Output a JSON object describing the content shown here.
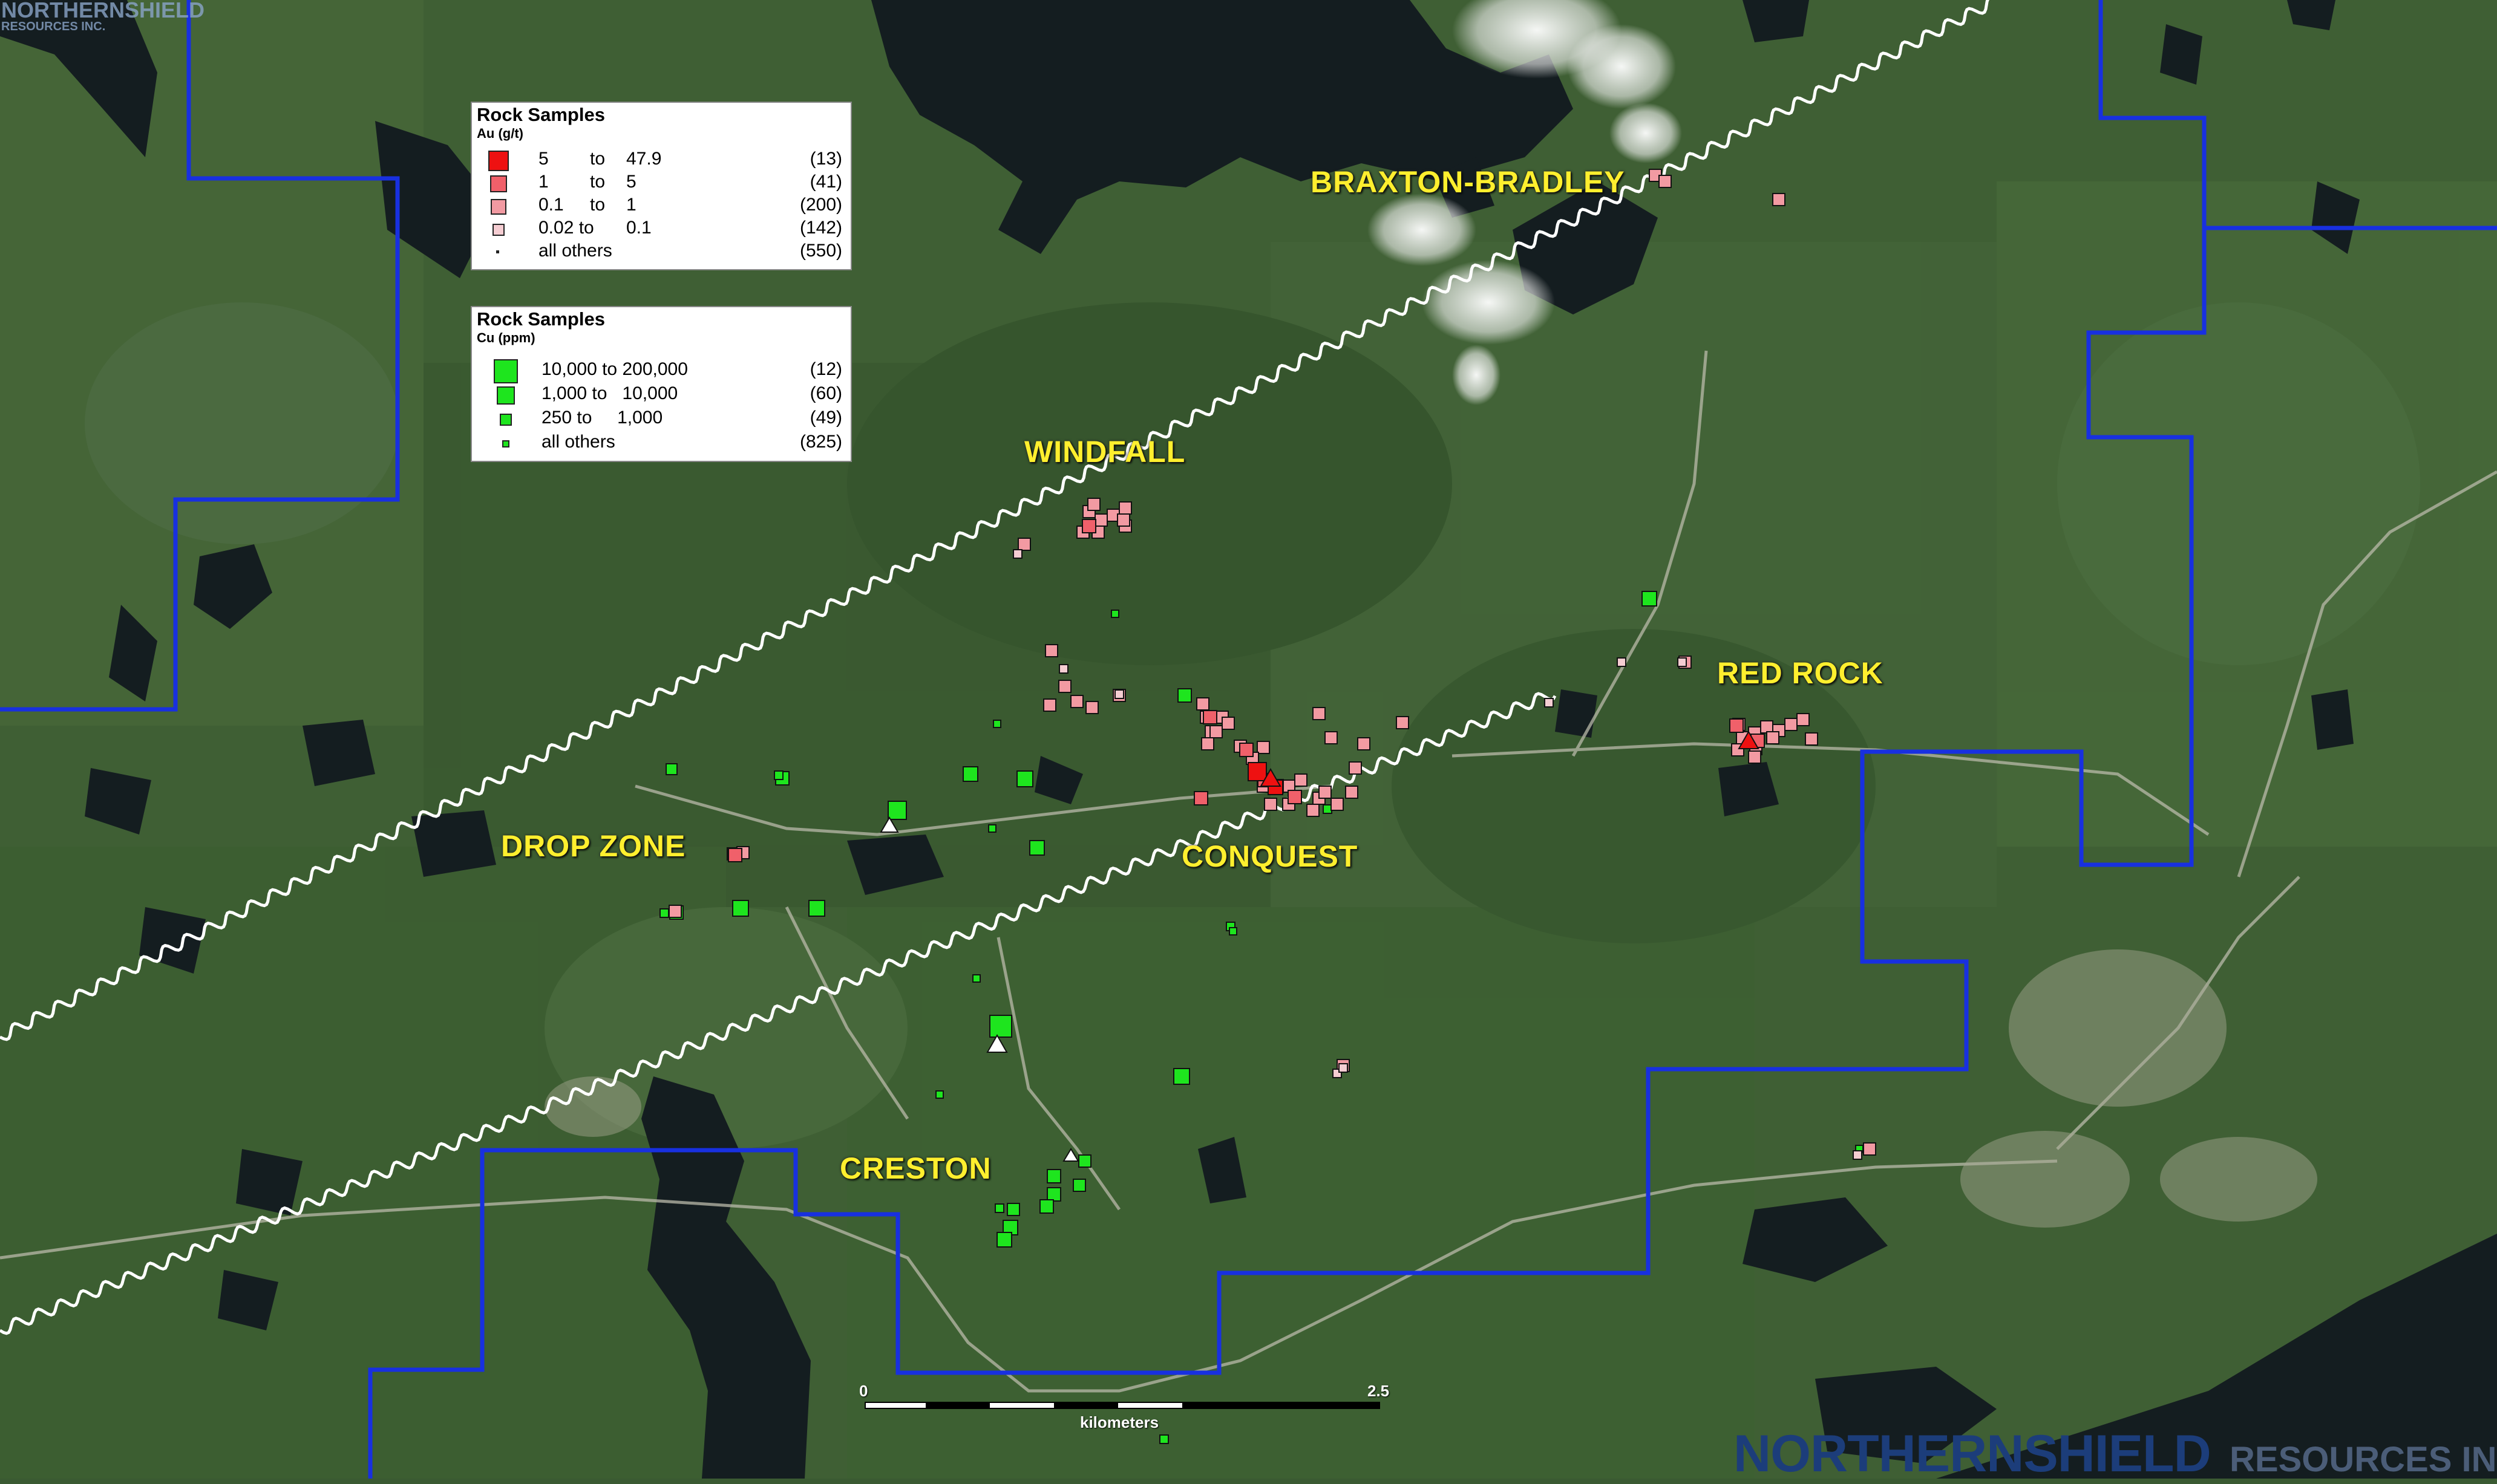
{
  "corner_logo": {
    "name": "NORTHERNSHIELD",
    "sub": "RESOURCES INC."
  },
  "legend_au": {
    "title": "Rock Samples",
    "unit": "Au (g/t)",
    "rows": [
      {
        "from": "5",
        "to_word": "to",
        "to": "47.9",
        "count": "(13)",
        "color": "#ee1111"
      },
      {
        "from": "1",
        "to_word": "to",
        "to": "5",
        "count": "(41)",
        "color": "#f0606a"
      },
      {
        "from": "0.1",
        "to_word": "to",
        "to": "1",
        "count": "(200)",
        "color": "#f29aa2"
      },
      {
        "from": "0.02 to",
        "to_word": "",
        "to": "0.1",
        "count": "(142)",
        "color": "#f5cdd2"
      },
      {
        "from": "",
        "to_word": "",
        "to": "all others",
        "count": "(550)",
        "color": "#f5f5f5"
      }
    ]
  },
  "legend_cu": {
    "title": "Rock Samples",
    "unit": "Cu (ppm)",
    "rows": [
      {
        "label": "10,000 to 200,000",
        "count": "(12)",
        "color": "#1ee51e"
      },
      {
        "label": "1,000 to   10,000",
        "count": "(60)",
        "color": "#1ee51e"
      },
      {
        "label": "250 to     1,000",
        "count": "(49)",
        "color": "#1ee51e"
      },
      {
        "label": "all others",
        "count": "(825)",
        "color": "#1ee51e"
      }
    ]
  },
  "labels": {
    "braxton": "BRAXTON-BRADLEY",
    "windfall": "WINDFALL",
    "redrock": "RED ROCK",
    "dropzone": "DROP ZONE",
    "conquest": "CONQUEST",
    "creston": "CRESTON"
  },
  "scale": {
    "start": "0",
    "end": "2.5",
    "unit": "kilometers"
  },
  "logo": {
    "main": "NORTHERNSHIELD",
    "sub": "RESOURCES INC"
  },
  "colors": {
    "boundary": "#1830e0",
    "au_high": "#ee1111",
    "au_mid": "#f0606a",
    "au_low": "#f29aa2",
    "au_trace": "#f5cdd2",
    "cu": "#1ee51e",
    "label": "#ffef2e"
  }
}
